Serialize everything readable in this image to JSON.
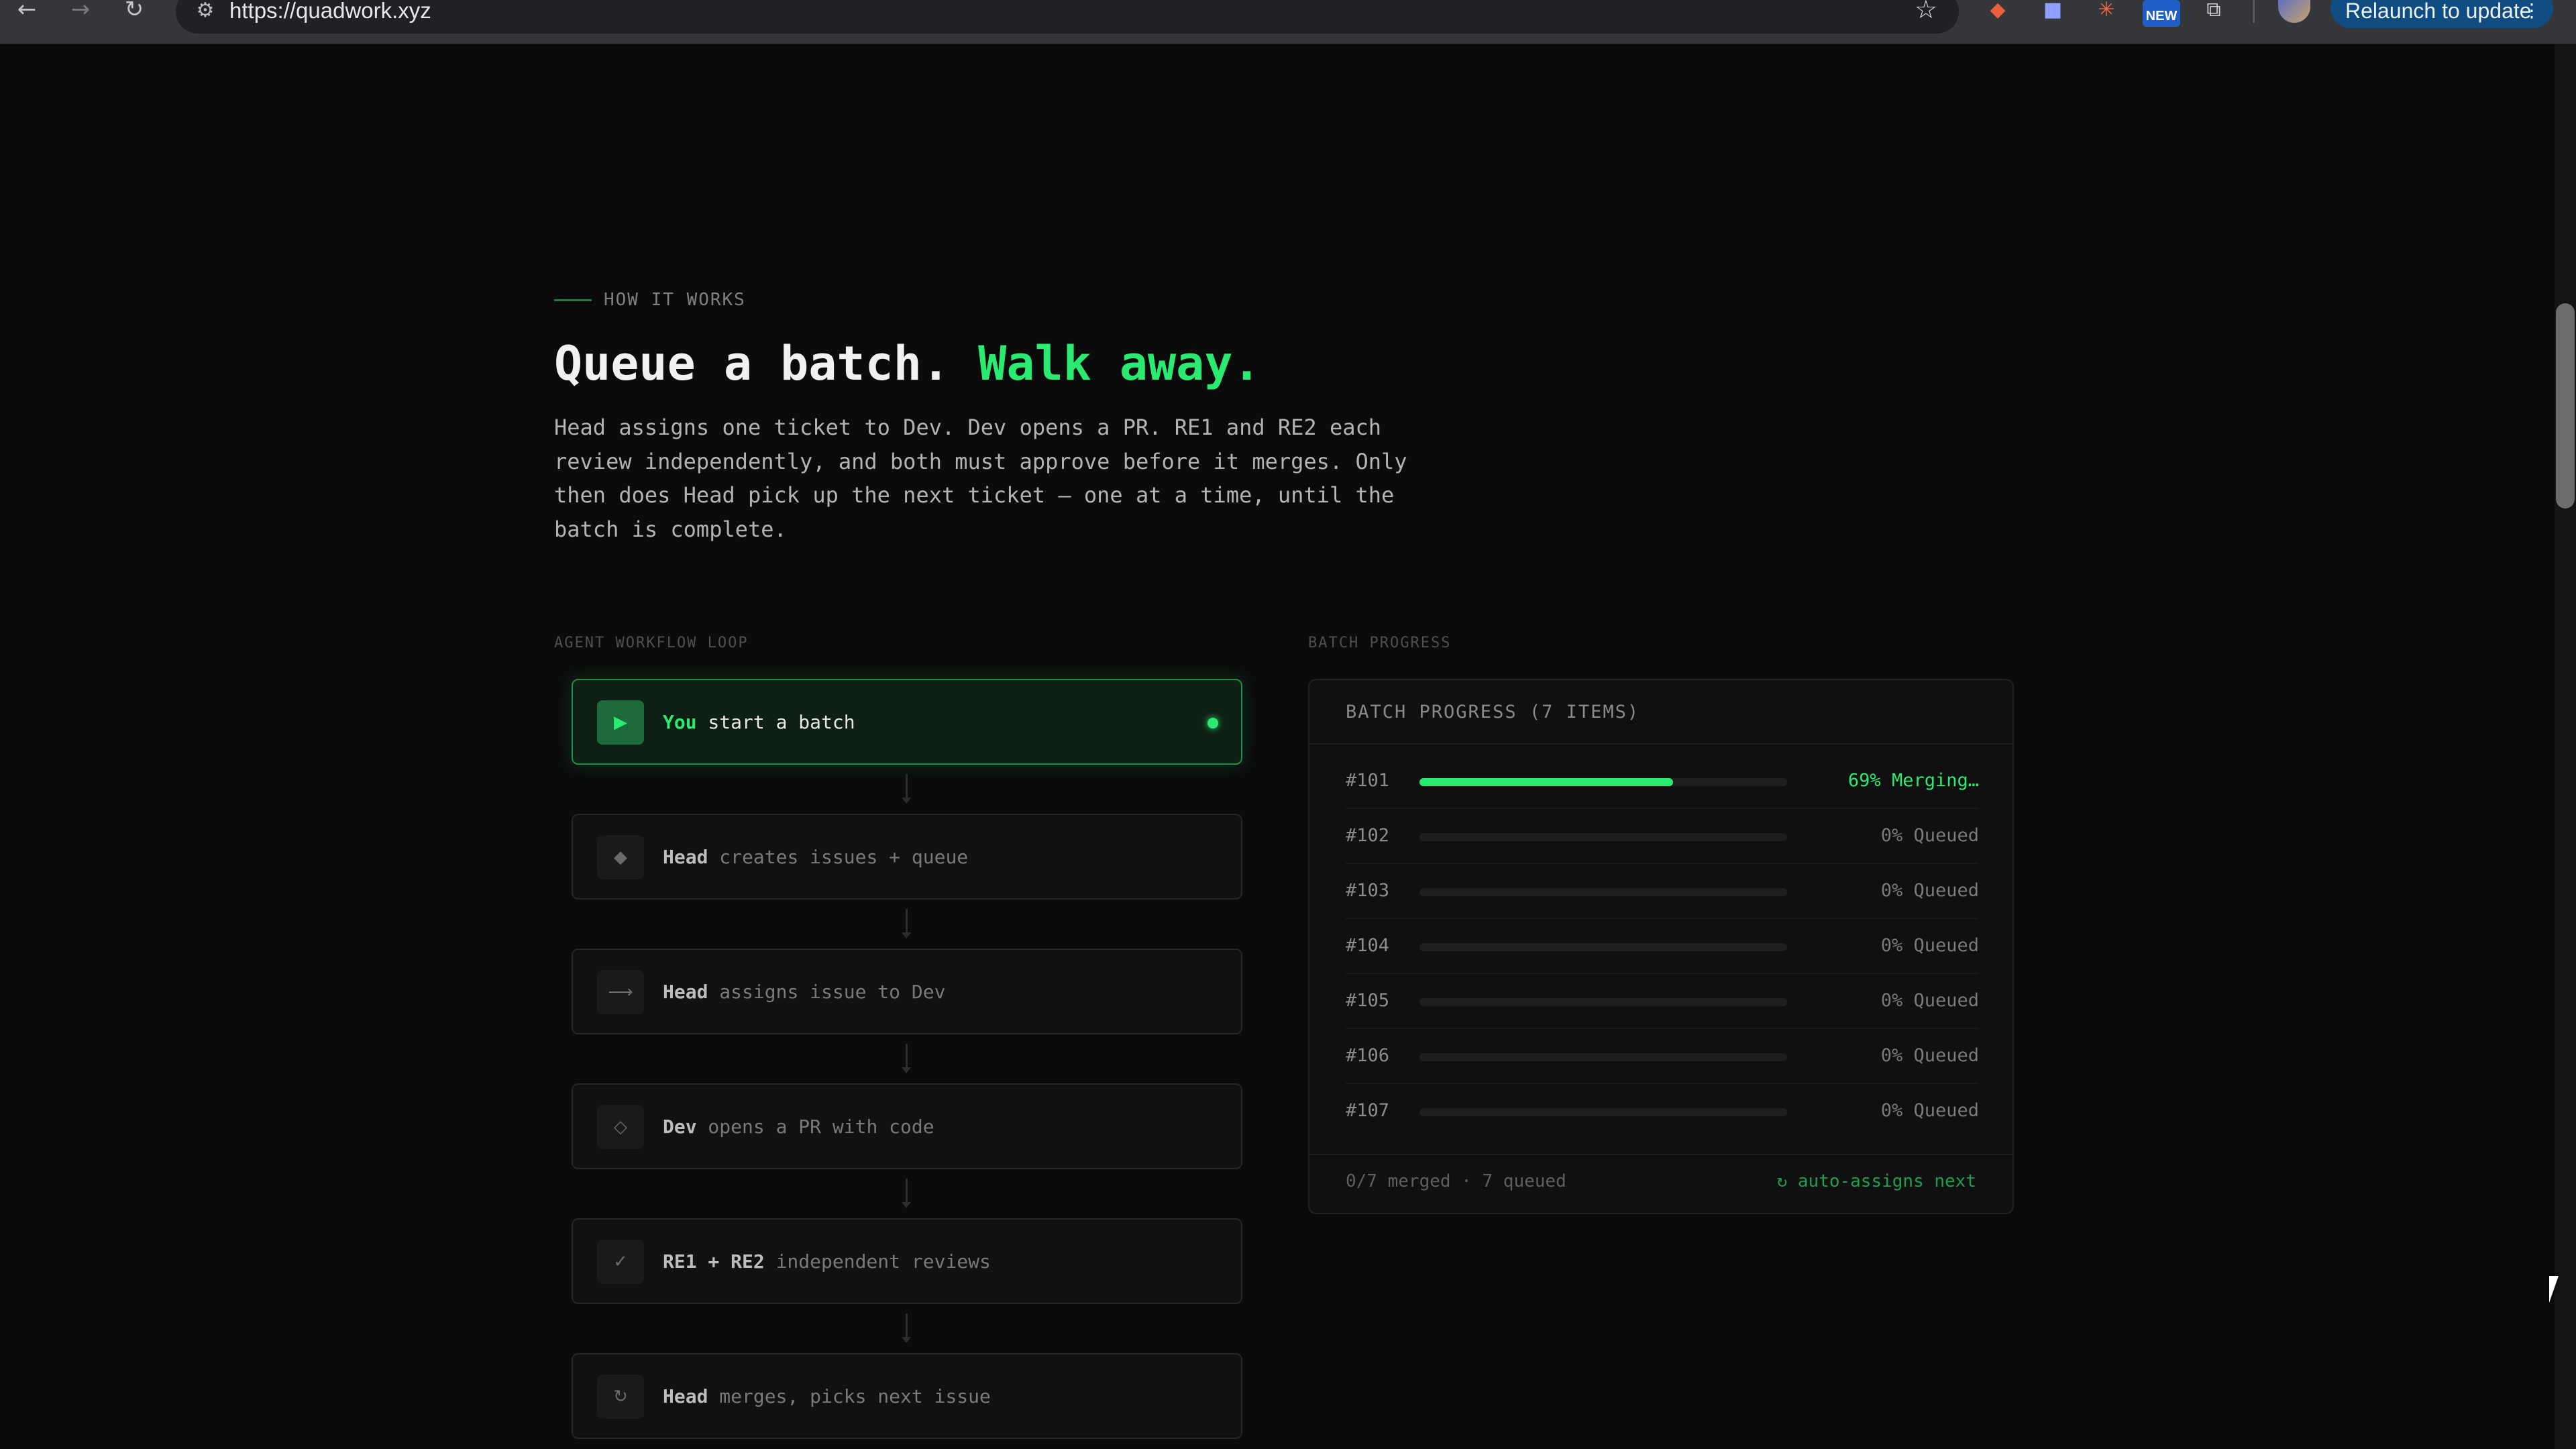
{
  "browser": {
    "back_icon": "arrow-left-icon",
    "forward_icon": "arrow-right-icon",
    "reload_icon": "reload-icon",
    "url": "https://quadwork.xyz",
    "bookmark_icon": "star-outline-icon",
    "new_badge": "NEW",
    "relaunch_label": "Relaunch to update"
  },
  "section": {
    "eyebrow": "HOW IT WORKS",
    "headline_main": "Queue a batch.",
    "headline_accent": "Walk away.",
    "lead": "Head assigns one ticket to Dev. Dev opens a PR. RE1 and RE2 each review independently, and both must approve before it merges. Only then does Head pick up the next ticket — one at a time, until the batch is complete.",
    "accent_color": "#2bea71"
  },
  "workflow": {
    "label": "AGENT WORKFLOW LOOP",
    "steps": [
      {
        "actor": "You",
        "action": " start a batch",
        "icon": "play-icon"
      },
      {
        "actor": "Head",
        "action": " creates issues + queue",
        "icon": "diamond-filled-icon"
      },
      {
        "actor": "Head",
        "action": " assigns issue to Dev",
        "icon": "arrow-right-icon"
      },
      {
        "actor": "Dev",
        "action": " opens a PR with code",
        "icon": "diamond-outline-icon"
      },
      {
        "actor": "RE1 + RE2",
        "action": " independent reviews",
        "icon": "check-icon"
      },
      {
        "actor": "Head",
        "action": " merges, picks next issue",
        "icon": "loop-icon"
      }
    ]
  },
  "batch": {
    "label": "BATCH PROGRESS",
    "title": "BATCH PROGRESS (7 ITEMS)",
    "items": [
      {
        "id": "#101",
        "progress": 69,
        "status": "69% Merging…"
      },
      {
        "id": "#102",
        "progress": 0,
        "status": "0% Queued"
      },
      {
        "id": "#103",
        "progress": 0,
        "status": "0% Queued"
      },
      {
        "id": "#104",
        "progress": 0,
        "status": "0% Queued"
      },
      {
        "id": "#105",
        "progress": 0,
        "status": "0% Queued"
      },
      {
        "id": "#106",
        "progress": 0,
        "status": "0% Queued"
      },
      {
        "id": "#107",
        "progress": 0,
        "status": "0% Queued"
      }
    ],
    "footer_left": "0/7 merged · 7 queued",
    "footer_right": "↻ auto-assigns next"
  }
}
